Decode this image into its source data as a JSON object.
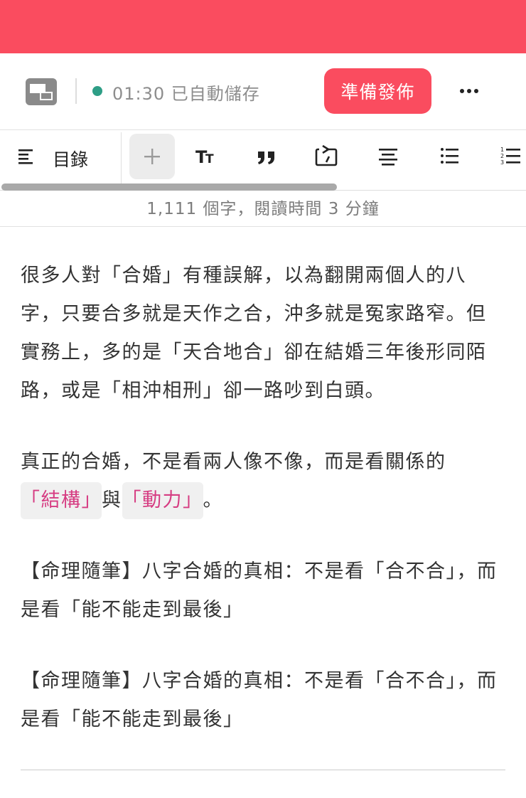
{
  "header": {
    "save_status": "01:30 已自動儲存",
    "publish_label": "準備發佈",
    "brand_color": "#fa4c5f",
    "status_dot_color": "#2e9e86"
  },
  "toolbar": {
    "toc_label": "目錄",
    "tools": [
      "plus-icon",
      "text-size-icon",
      "quote-icon",
      "embed-icon",
      "align-center-icon",
      "bullet-list-icon",
      "numbered-list-icon"
    ]
  },
  "stats": {
    "word_count_text": "1,111 個字，閱讀時間 3 分鐘"
  },
  "content": {
    "p1": "很多人對「合婚」有種誤解，以為翻開兩個人的八字，只要合多就是天作之合，沖多就是冤家路窄。但實務上，多的是「天合地合」卻在結婚三年後形同陌路，或是「相沖相刑」卻一路吵到白頭。",
    "p2_text": "真正的合婚，不是看兩人像不像，而是看關係的",
    "p2_highlight1": "「結構」",
    "p2_mid": "與",
    "p2_highlight2": "「動力」",
    "p2_end": "。",
    "p3": "【命理隨筆】八字合婚的真相：不是看「合不合」，而是看「能不能走到最後」",
    "p4": "【命理隨筆】八字合婚的真相：不是看「合不合」，而是看「能不能走到最後」"
  }
}
